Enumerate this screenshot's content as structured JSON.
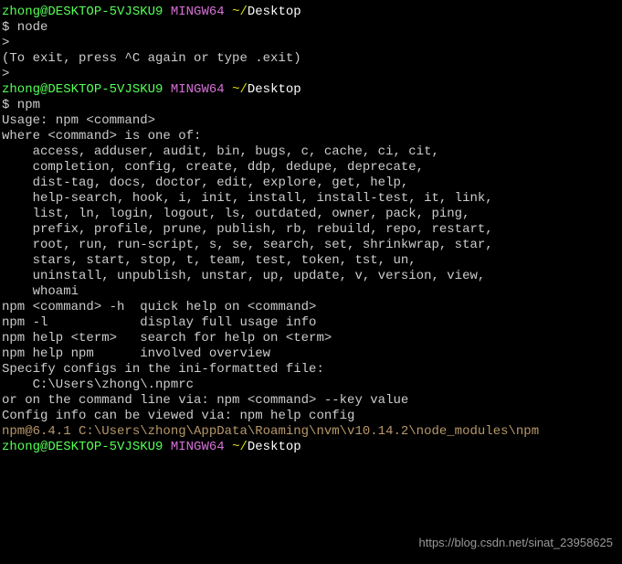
{
  "prompt1": {
    "user": "zhong@DESKTOP-5VJSKU9",
    "host": "MINGW64",
    "tilde": "~/",
    "path": "Desktop"
  },
  "cmd1": "$ node",
  "node_out1": ">",
  "node_out2": "(To exit, press ^C again or type .exit)",
  "node_out3": ">",
  "blank": "",
  "prompt2": {
    "user": "zhong@DESKTOP-5VJSKU9",
    "host": "MINGW64",
    "tilde": "~/",
    "path": "Desktop"
  },
  "cmd2": "$ npm",
  "npm_usage": "Usage: npm <command>",
  "npm_where": "where <command> is one of:",
  "npm_list1": "    access, adduser, audit, bin, bugs, c, cache, ci, cit,",
  "npm_list2": "    completion, config, create, ddp, dedupe, deprecate,",
  "npm_list3": "    dist-tag, docs, doctor, edit, explore, get, help,",
  "npm_list4": "    help-search, hook, i, init, install, install-test, it, link,",
  "npm_list5": "    list, ln, login, logout, ls, outdated, owner, pack, ping,",
  "npm_list6": "    prefix, profile, prune, publish, rb, rebuild, repo, restart,",
  "npm_list7": "    root, run, run-script, s, se, search, set, shrinkwrap, star,",
  "npm_list8": "    stars, start, stop, t, team, test, token, tst, un,",
  "npm_list9": "    uninstall, unpublish, unstar, up, update, v, version, view,",
  "npm_list10": "    whoami",
  "npm_help1": "npm <command> -h  quick help on <command>",
  "npm_help2": "npm -l            display full usage info",
  "npm_help3": "npm help <term>   search for help on <term>",
  "npm_help4": "npm help npm      involved overview",
  "npm_cfg1": "Specify configs in the ini-formatted file:",
  "npm_cfg2": "    C:\\Users\\zhong\\.npmrc",
  "npm_cfg3": "or on the command line via: npm <command> --key value",
  "npm_cfg4": "Config info can be viewed via: npm help config",
  "npm_version": "npm@6.4.1 C:\\Users\\zhong\\AppData\\Roaming\\nvm\\v10.14.2\\node_modules\\npm",
  "prompt3": {
    "user": "zhong@DESKTOP-5VJSKU9",
    "host": "MINGW64",
    "tilde": "~/",
    "path": "Desktop"
  },
  "watermark": "https://blog.csdn.net/sinat_23958625"
}
